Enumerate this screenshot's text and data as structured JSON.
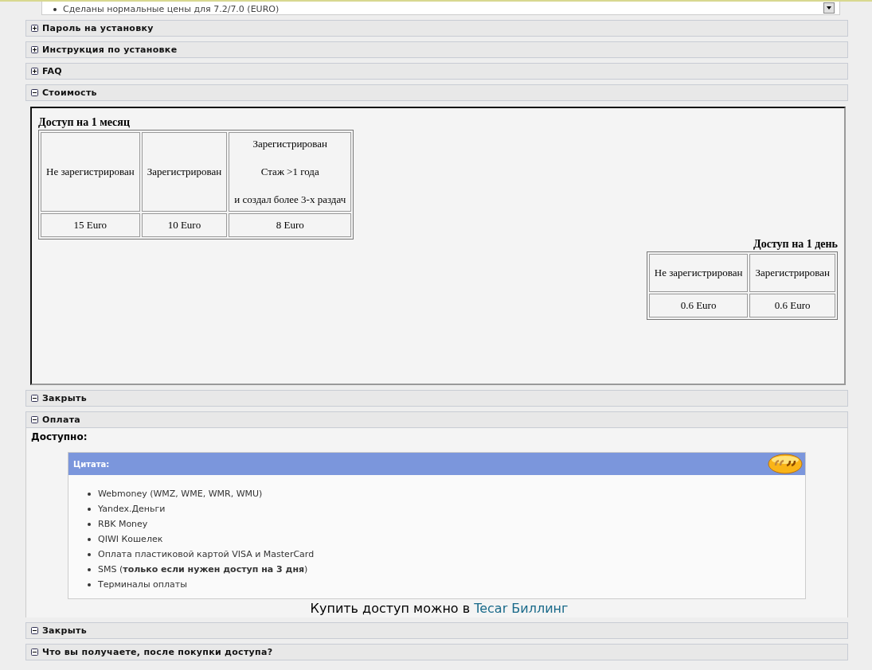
{
  "top_snippet": {
    "text": "Сделаны нормальные цены для 7.2/7.0 (EURO)"
  },
  "sections": [
    {
      "title": "Пароль на установку",
      "expanded": false
    },
    {
      "title": "Инструкция по установке",
      "expanded": false
    },
    {
      "title": "FAQ",
      "expanded": false
    },
    {
      "kind": "pricing",
      "title": "Стоимость",
      "expanded": true,
      "tables": [
        {
          "caption": "Доступ на 1 месяц",
          "headers": [
            [
              "Не зарегистрирован"
            ],
            [
              "Зарегистрирован"
            ],
            [
              "Зарегистрирован",
              "Стаж >1 года",
              "и создал более 3-х раздач"
            ]
          ],
          "prices": [
            "15 Euro",
            "10 Euro",
            "8 Euro"
          ]
        },
        {
          "caption": "Доступ на 1 день",
          "headers": [
            [
              "Не зарегистрирован"
            ],
            [
              "Зарегистрирован"
            ]
          ],
          "prices": [
            "0.6 Euro",
            "0.6 Euro"
          ]
        }
      ]
    },
    {
      "title": "Закрыть",
      "expanded": true
    },
    {
      "kind": "payment",
      "title": "Оплата",
      "expanded": true,
      "available_label": "Доступно:",
      "quote_title": "Цитата:",
      "items": [
        "Webmoney (WMZ, WME, WMR, WMU)",
        "Yandex.Деньги",
        "RBK Money",
        "QIWI Кошелек",
        "Оплата пластиковой картой VISA и MasterCard",
        "SMS (**только если нужен доступ на 3 дня**)",
        "Терминалы оплаты"
      ],
      "buy_text": "Купить доступ можно в",
      "buy_link": "Tecar Биллинг"
    },
    {
      "title": "Закрыть",
      "expanded": true
    },
    {
      "title": "Что вы получаете, после покупки доступа?",
      "expanded": true
    }
  ]
}
